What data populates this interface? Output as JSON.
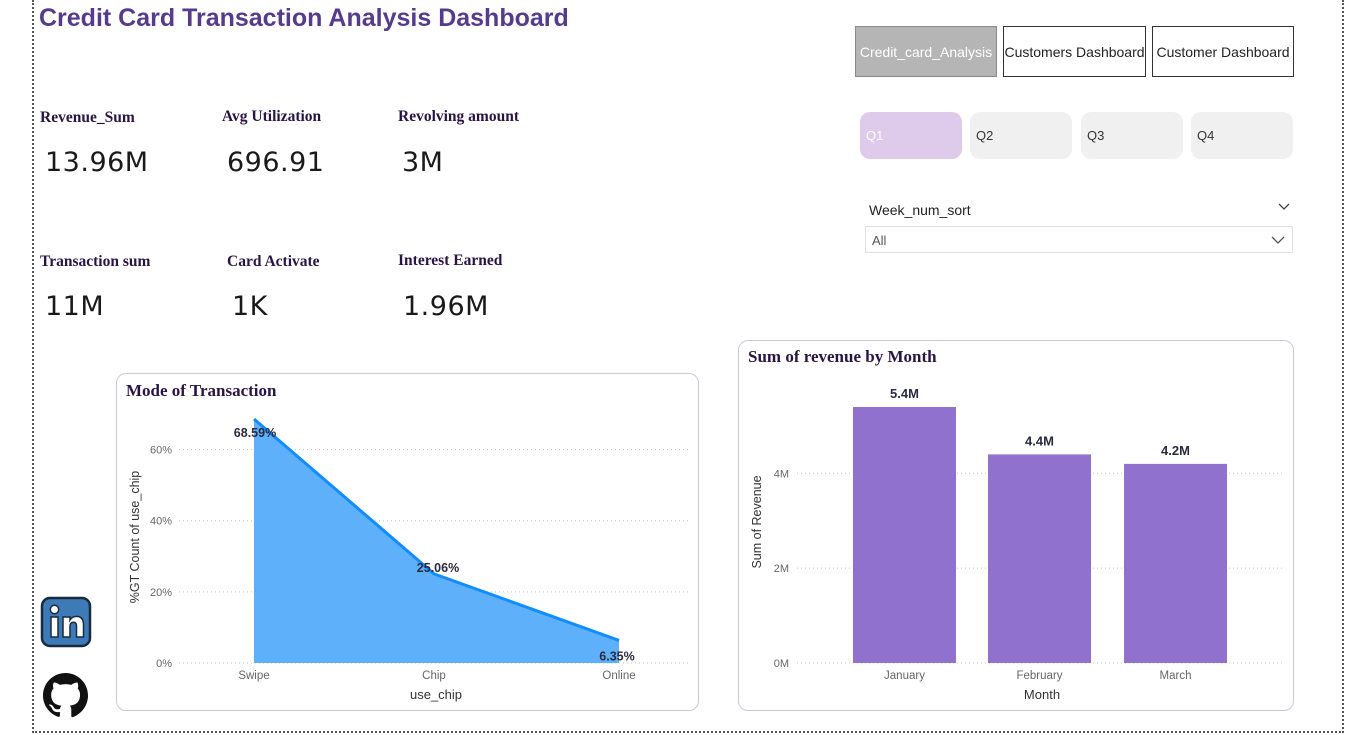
{
  "title": "Credit Card Transaction Analysis Dashboard",
  "nav": [
    {
      "label": "Credit_card_Analysis",
      "active": true
    },
    {
      "label": "Customers Dashboard",
      "active": false
    },
    {
      "label": "Customer Dashboard",
      "active": false
    }
  ],
  "kpis": [
    {
      "label": "Revenue_Sum",
      "value": "13.96M"
    },
    {
      "label": "Avg Utilization",
      "value": "696.91"
    },
    {
      "label": "Revolving amount",
      "value": "3M"
    },
    {
      "label": "Transaction sum",
      "value": "11M"
    },
    {
      "label": "Card Activate",
      "value": "1K"
    },
    {
      "label": "Interest Earned",
      "value": "1.96M"
    }
  ],
  "quarters": [
    {
      "label": "Q1",
      "selected": true
    },
    {
      "label": "Q2",
      "selected": false
    },
    {
      "label": "Q3",
      "selected": false
    },
    {
      "label": "Q4",
      "selected": false
    }
  ],
  "week_slicer": {
    "title": "Week_num_sort",
    "value": "All"
  },
  "icons": {
    "linkedin": "linkedin-icon",
    "github": "github-icon",
    "chevron": "chevron-down-icon"
  },
  "colors": {
    "title": "#553a8e",
    "area": "#5fb0fb",
    "area_line": "#118dff",
    "bar": "#9071ce",
    "q_selected": "#decaea"
  },
  "chart_data": [
    {
      "type": "area",
      "title": "Mode of Transaction",
      "xlabel": "use_chip",
      "ylabel": "%GT Count of use_chip",
      "categories": [
        "Swipe",
        "Chip",
        "Online"
      ],
      "values": [
        68.59,
        25.06,
        6.35
      ],
      "data_labels": [
        "68.59%",
        "25.06%",
        "6.35%"
      ],
      "yticks": [
        "0%",
        "20%",
        "40%",
        "60%"
      ],
      "ytick_values": [
        0,
        20,
        40,
        60
      ],
      "ylim": [
        0,
        68.59
      ],
      "grid": true
    },
    {
      "type": "bar",
      "title": "Sum of revenue by Month",
      "xlabel": "Month",
      "ylabel": "Sum of Revenue",
      "categories": [
        "January",
        "February",
        "March"
      ],
      "values": [
        5.4,
        4.4,
        4.2
      ],
      "data_labels": [
        "5.4M",
        "4.4M",
        "4.2M"
      ],
      "yticks": [
        "0M",
        "2M",
        "4M"
      ],
      "ytick_values": [
        0,
        2,
        4
      ],
      "ylim": [
        0,
        5.4
      ],
      "grid": true
    }
  ]
}
